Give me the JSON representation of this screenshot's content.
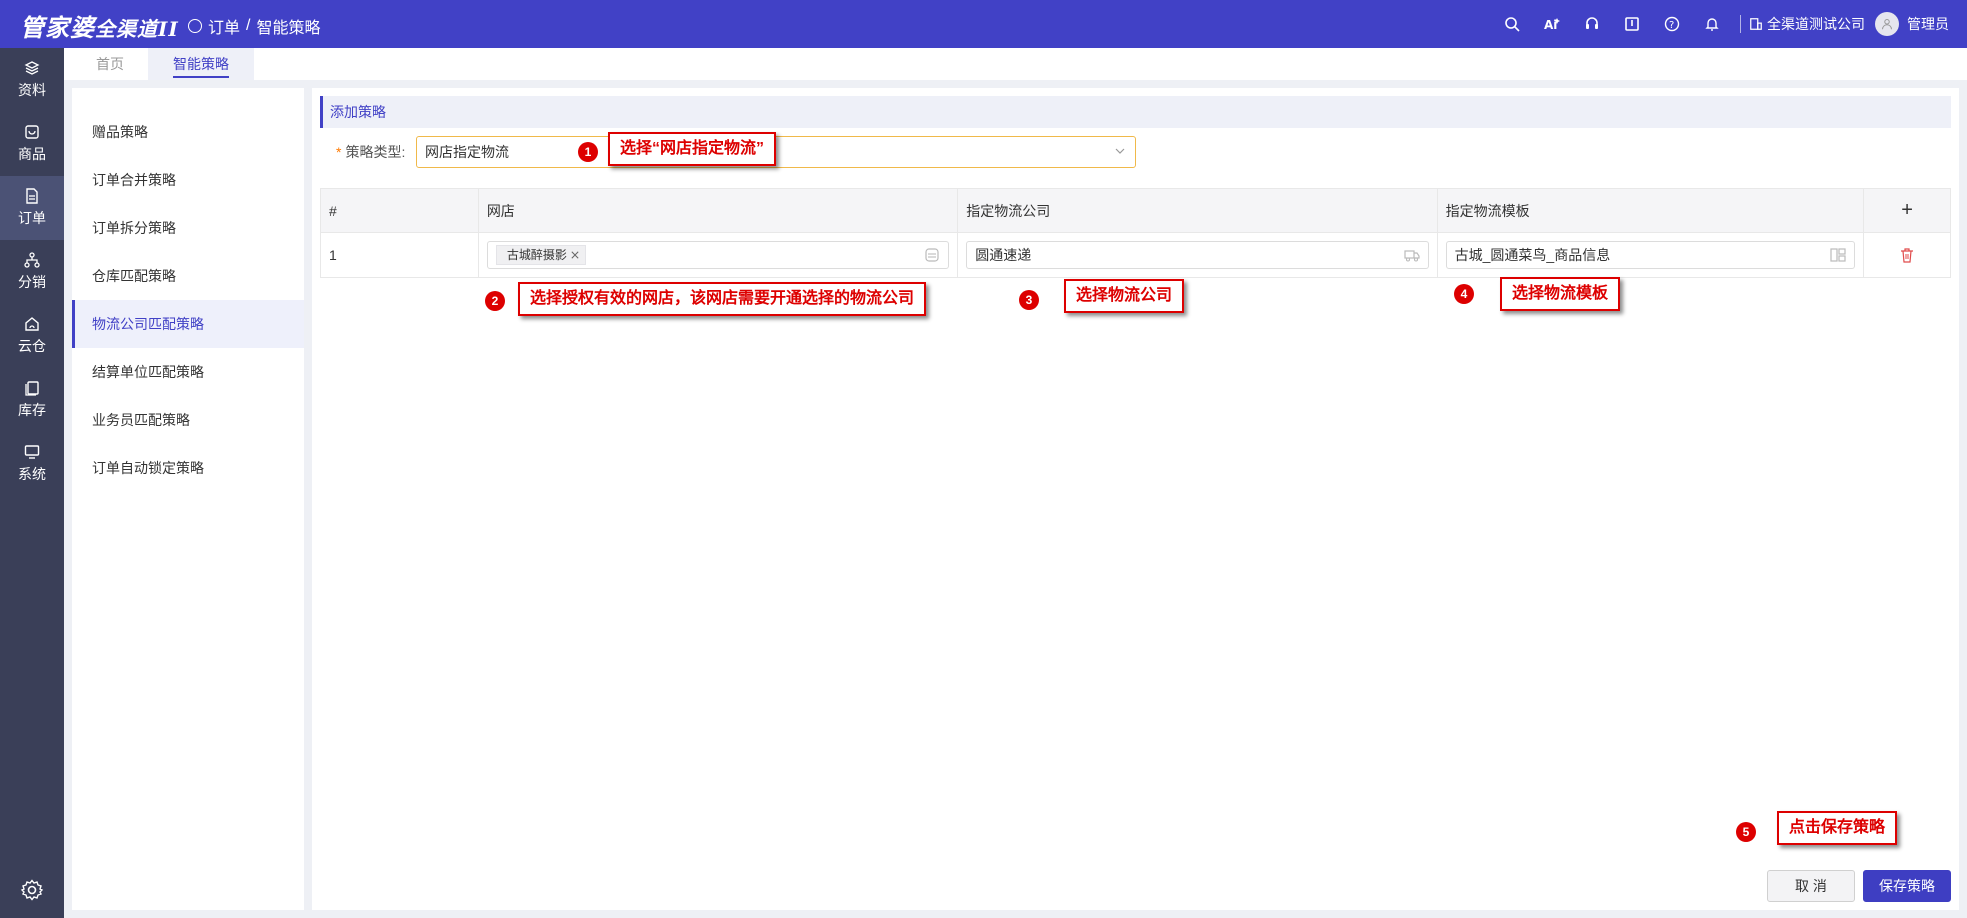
{
  "topbar": {
    "logo": "管家婆",
    "logo_sub": "全渠道II",
    "breadcrumb_parent": "订单",
    "breadcrumb_sep": "/",
    "breadcrumb_current": "智能策略",
    "company": "全渠道测试公司",
    "user": "管理员",
    "icons": [
      "search-icon",
      "ai-icon",
      "headset-icon",
      "book-icon",
      "help-icon",
      "bell-icon",
      "building-icon",
      "user-icon"
    ]
  },
  "leftnav": {
    "items": [
      {
        "label": "资料",
        "icon": "layers-icon"
      },
      {
        "label": "商品",
        "icon": "box-icon"
      },
      {
        "label": "订单",
        "icon": "document-icon"
      },
      {
        "label": "分销",
        "icon": "network-icon"
      },
      {
        "label": "云仓",
        "icon": "cloud-home-icon"
      },
      {
        "label": "库存",
        "icon": "inventory-icon"
      },
      {
        "label": "系统",
        "icon": "monitor-icon"
      }
    ],
    "active_index": 2,
    "settings_icon": "gear-icon"
  },
  "tabs": [
    {
      "label": "首页"
    },
    {
      "label": "智能策略"
    }
  ],
  "sidebar": {
    "items": [
      {
        "label": "赠品策略"
      },
      {
        "label": "订单合并策略"
      },
      {
        "label": "订单拆分策略"
      },
      {
        "label": "仓库匹配策略"
      },
      {
        "label": "物流公司匹配策略"
      },
      {
        "label": "结算单位匹配策略"
      },
      {
        "label": "业务员匹配策略"
      },
      {
        "label": "订单自动锁定策略"
      }
    ],
    "active_index": 4
  },
  "main": {
    "section_title": "添加策略",
    "required_mark": "*",
    "type_label": "策略类型:",
    "type_value": "网店指定物流",
    "table": {
      "headers": [
        "#",
        "网店",
        "指定物流公司",
        "指定物流模板",
        "+"
      ],
      "rows": [
        {
          "index": "1",
          "shop_tag": "古城醉摄影",
          "logistics_company": "圆通速递",
          "logistics_template": "古城_圆通菜鸟_商品信息"
        }
      ]
    },
    "cancel_label": "取 消",
    "save_label": "保存策略"
  },
  "annotations": [
    {
      "num": "1",
      "text": "选择“网店指定物流”"
    },
    {
      "num": "2",
      "text": "选择授权有效的网店，该网店需要开通选择的物流公司"
    },
    {
      "num": "3",
      "text": "选择物流公司"
    },
    {
      "num": "4",
      "text": "选择物流模板"
    },
    {
      "num": "5",
      "text": "点击保存策略"
    }
  ],
  "colors": {
    "brand": "#4141c6",
    "nav_bg": "#3a3f58",
    "annotation_red": "#dd0000",
    "select_border": "#f0b94a"
  }
}
